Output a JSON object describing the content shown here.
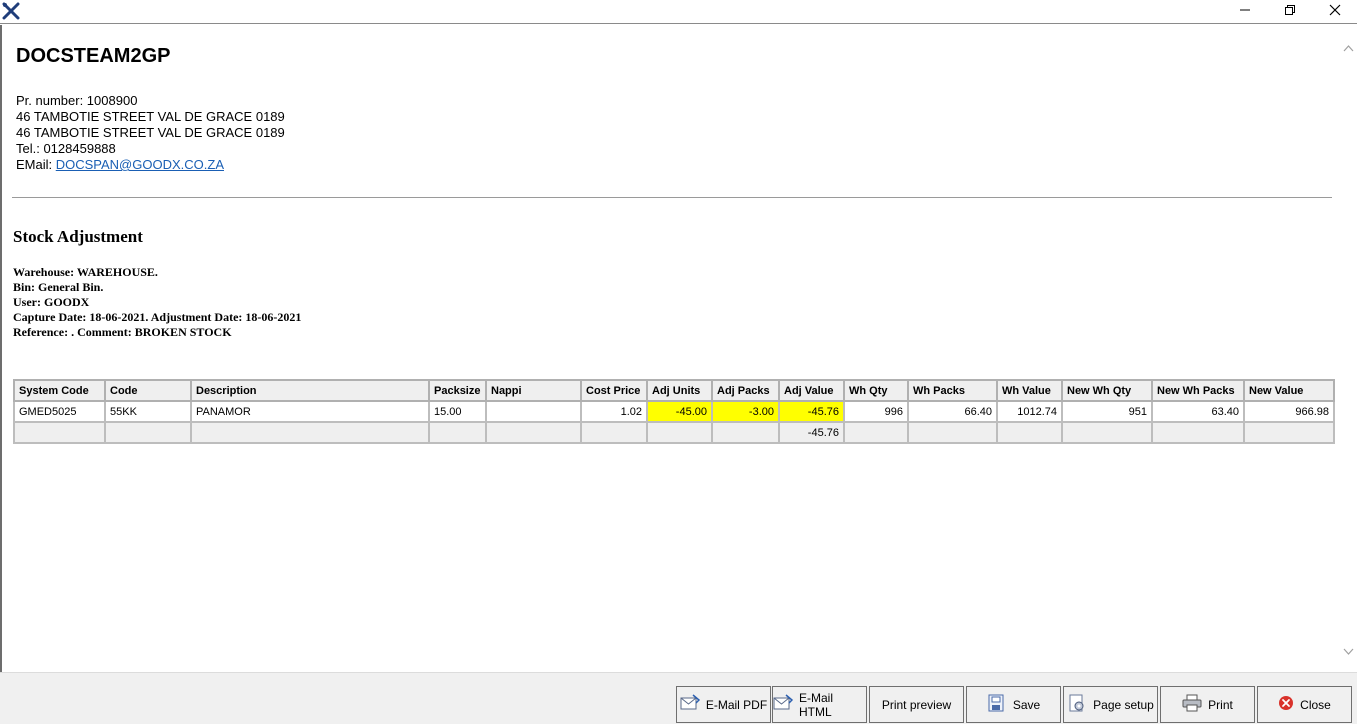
{
  "window": {
    "app_icon": "crossed-tools-icon",
    "controls": [
      "minimize-icon",
      "restore-icon",
      "close-icon"
    ]
  },
  "company": {
    "name": "DOCSTEAM2GP",
    "pr_number": "Pr. number: 1008900",
    "address_line1": "46 TAMBOTIE STREET VAL DE GRACE 0189",
    "address_line2": "46 TAMBOTIE STREET VAL DE GRACE 0189",
    "tel": "Tel.: 0128459888",
    "email_label": "EMail: ",
    "email": "DOCSPAN@GOODX.CO.ZA"
  },
  "report": {
    "title": "Stock Adjustment",
    "warehouse": "Warehouse: WAREHOUSE.",
    "bin": "Bin: General Bin.",
    "user": "User: GOODX",
    "dates": "Capture Date: 18-06-2021. Adjustment Date: 18-06-2021",
    "reference": "Reference: . Comment: BROKEN STOCK"
  },
  "table": {
    "columns": [
      "System Code",
      "Code",
      "Description",
      "Packsize",
      "Nappi",
      "Cost Price",
      "Adj Units",
      "Adj Packs",
      "Adj Value",
      "Wh Qty",
      "Wh Packs",
      "Wh Value",
      "New Wh Qty",
      "New Wh Packs",
      "New Value"
    ],
    "rows": [
      [
        "GMED5025",
        "55KK",
        "PANAMOR",
        "15.00",
        "",
        "1.02",
        "-45.00",
        "-3.00",
        "-45.76",
        "996",
        "66.40",
        "1012.74",
        "951",
        "63.40",
        "966.98"
      ]
    ],
    "totals": [
      "",
      "",
      "",
      "",
      "",
      "",
      "",
      "",
      "-45.76",
      "",
      "",
      "",
      "",
      "",
      ""
    ],
    "highlight_color": "#ffff00"
  },
  "toolbar": {
    "email_pdf": "E-Mail PDF",
    "email_html": "E-Mail HTML",
    "print_preview": "Print preview",
    "save": "Save",
    "page_setup": "Page setup",
    "print": "Print",
    "close": "Close"
  }
}
